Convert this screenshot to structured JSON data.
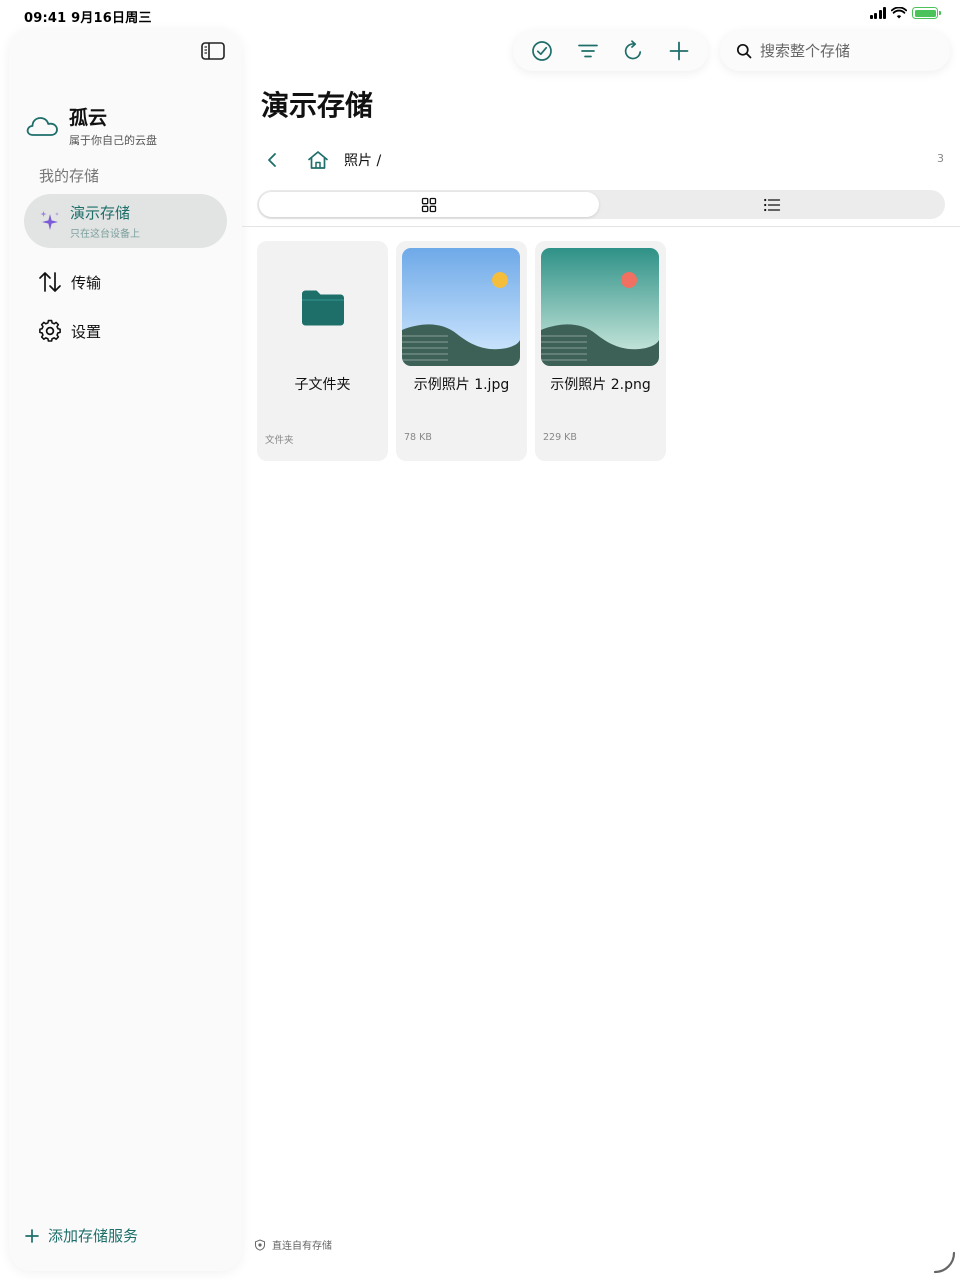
{
  "status_bar": {
    "time": "09:41  9月16日周三"
  },
  "sidebar": {
    "brand_title": "孤云",
    "brand_subtitle": "属于你自己的云盘",
    "section_label": "我的存储",
    "storage": {
      "name": "演示存储",
      "subtitle": "只在这台设备上"
    },
    "nav": [
      {
        "label": "传输",
        "icon": "transfer-arrows-icon"
      },
      {
        "label": "设置",
        "icon": "gear-icon"
      }
    ],
    "add_service_label": "添加存储服务"
  },
  "search": {
    "placeholder": "搜索整个存储"
  },
  "main": {
    "title": "演示存储",
    "breadcrumb": "照片 /",
    "item_count": "3",
    "view_modes": [
      "grid",
      "list"
    ],
    "active_view": "grid",
    "items": [
      {
        "name": "子文件夹",
        "meta": "文件夹",
        "kind": "folder"
      },
      {
        "name": "示例照片 1.jpg",
        "meta": "78 KB",
        "kind": "image",
        "sun_color": "#f5bd3c",
        "sky_top": "#6ea9e8",
        "sky_bottom": "#d6ebff"
      },
      {
        "name": "示例照片 2.png",
        "meta": "229 KB",
        "kind": "image",
        "sun_color": "#f07062",
        "sky_top": "#2e9187",
        "sky_bottom": "#d8efe4"
      }
    ]
  },
  "footer_note": "直连自有存储",
  "colors": {
    "accent": "#1e6e6a",
    "sparkle": "#7b5cd6"
  }
}
